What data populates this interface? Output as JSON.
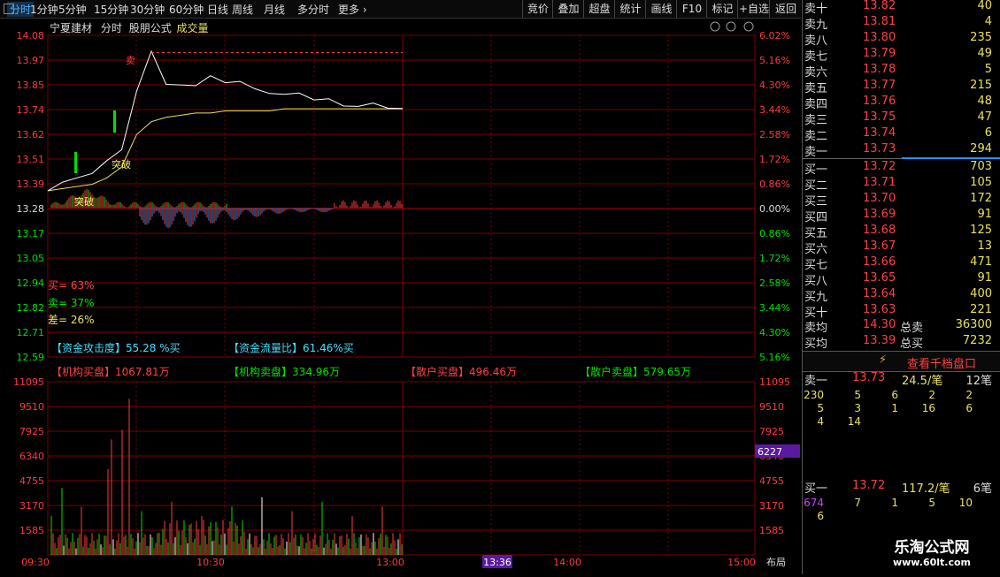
{
  "colors": {
    "up": "#ff3b3b",
    "down": "#00e000",
    "grid": "#7a0000",
    "price_line": "#ffffff",
    "avg_line": "#e8e060",
    "blue": "#1e90ff",
    "cyan": "#44ddff"
  },
  "topbar": {
    "tabs": [
      "分时",
      "1分钟",
      "5分钟",
      "15分钟",
      "30分钟",
      "60分钟",
      "日线",
      "周线",
      "月线",
      "多分时",
      "更多"
    ],
    "active": "分时",
    "right_buttons": [
      "竞价",
      "叠加",
      "超盘",
      "统计",
      "画线",
      "F10",
      "标记",
      "+自选",
      "返回"
    ]
  },
  "chart_header": {
    "stock_name": "宁夏建材",
    "mode": "分时",
    "formula": "股朋公式",
    "vol_label": "成交量"
  },
  "price_axis": {
    "left": [
      "14.08",
      "13.97",
      "13.85",
      "13.74",
      "13.62",
      "13.51",
      "13.39",
      "13.28",
      "13.17",
      "13.05",
      "12.94",
      "12.82",
      "12.71",
      "12.59"
    ],
    "right": [
      "6.02%",
      "5.16%",
      "4.30%",
      "3.44%",
      "2.58%",
      "1.72%",
      "0.86%",
      "0.00%",
      "0.86%",
      "1.72%",
      "2.58%",
      "3.44%",
      "4.30%",
      "5.16%"
    ]
  },
  "volume_axis": {
    "labels": [
      "11095",
      "9510",
      "7925",
      "6340",
      "4755",
      "3170",
      "1585"
    ],
    "marker": "6227"
  },
  "time_axis": {
    "labels": [
      "09:30",
      "10:30",
      "13:00",
      "14:00",
      "15:00"
    ],
    "cursor_time": "13:36",
    "layout_btn": "布局"
  },
  "annotations": {
    "sell_mark": "卖",
    "breakout1": "突破",
    "breakout2": "突破"
  },
  "ratios": {
    "buy": "买= 63%",
    "sell": "卖= 37%",
    "diff": "差= 26%"
  },
  "fund": {
    "attack": "【资金攻击度】55.28 %买",
    "flow": "【资金流量比】61.46%买",
    "inst_buy": "【机构买盘】1067.81万",
    "inst_sell": "【机构卖盘】334.96万",
    "retail_buy": "【散户买盘】496.46万",
    "retail_sell": "【散户卖盘】579.65万"
  },
  "chart_data": {
    "type": "line",
    "title": "宁夏建材 分时",
    "prev_close": 13.28,
    "ylim": [
      12.59,
      14.08
    ],
    "x": [
      "09:30",
      "09:35",
      "09:40",
      "09:45",
      "09:50",
      "09:55",
      "10:00",
      "10:05",
      "10:10",
      "10:15",
      "10:20",
      "10:25",
      "10:30",
      "10:35",
      "10:40",
      "10:45",
      "10:50",
      "10:55",
      "11:00",
      "11:05",
      "11:10",
      "11:15",
      "11:20",
      "11:25",
      "11:30"
    ],
    "series": [
      {
        "name": "price",
        "values": [
          13.36,
          13.4,
          13.42,
          13.44,
          13.5,
          13.55,
          13.82,
          14.0,
          13.86,
          13.85,
          13.84,
          13.9,
          13.86,
          13.86,
          13.84,
          13.81,
          13.8,
          13.82,
          13.78,
          13.78,
          13.76,
          13.75,
          13.76,
          13.75,
          13.74
        ]
      },
      {
        "name": "avg",
        "values": [
          13.36,
          13.37,
          13.38,
          13.39,
          13.42,
          13.47,
          13.62,
          13.68,
          13.7,
          13.71,
          13.72,
          13.72,
          13.73,
          13.73,
          13.73,
          13.73,
          13.74,
          13.74,
          13.74,
          13.74,
          13.74,
          13.74,
          13.74,
          13.74,
          13.74
        ]
      }
    ],
    "volume_ylim": [
      0,
      11095
    ]
  },
  "orderbook": {
    "asks": [
      {
        "label": "卖十",
        "price": "13.82",
        "vol": "40"
      },
      {
        "label": "卖九",
        "price": "13.81",
        "vol": "4"
      },
      {
        "label": "卖八",
        "price": "13.80",
        "vol": "235"
      },
      {
        "label": "卖七",
        "price": "13.79",
        "vol": "49"
      },
      {
        "label": "卖六",
        "price": "13.78",
        "vol": "5"
      },
      {
        "label": "卖五",
        "price": "13.77",
        "vol": "215"
      },
      {
        "label": "卖四",
        "price": "13.76",
        "vol": "48"
      },
      {
        "label": "卖三",
        "price": "13.75",
        "vol": "47"
      },
      {
        "label": "卖二",
        "price": "13.74",
        "vol": "6"
      },
      {
        "label": "卖一",
        "price": "13.73",
        "vol": "294"
      }
    ],
    "bids": [
      {
        "label": "买一",
        "price": "13.72",
        "vol": "703"
      },
      {
        "label": "买二",
        "price": "13.71",
        "vol": "105"
      },
      {
        "label": "买三",
        "price": "13.70",
        "vol": "172"
      },
      {
        "label": "买四",
        "price": "13.69",
        "vol": "91"
      },
      {
        "label": "买五",
        "price": "13.68",
        "vol": "125"
      },
      {
        "label": "买六",
        "price": "13.67",
        "vol": "13"
      },
      {
        "label": "买七",
        "price": "13.66",
        "vol": "471"
      },
      {
        "label": "买八",
        "price": "13.65",
        "vol": "91"
      },
      {
        "label": "买九",
        "price": "13.64",
        "vol": "400"
      },
      {
        "label": "买十",
        "price": "13.63",
        "vol": "221"
      }
    ],
    "ask_avg": {
      "label": "卖均",
      "price": "14.30",
      "tlabel": "总卖",
      "tval": "36300"
    },
    "bid_avg": {
      "label": "买均",
      "price": "13.39",
      "tlabel": "总买",
      "tval": "7232"
    },
    "detail_btn": "查看千档盘口",
    "sell1": {
      "label": "卖一",
      "price": "13.73",
      "per": "24.5/笔",
      "count": "12笔",
      "rows": [
        [
          "230",
          "5",
          "6",
          "2",
          "2"
        ],
        [
          "5",
          "3",
          "1",
          "16",
          "6"
        ],
        [
          "4",
          "14",
          "",
          "",
          ""
        ]
      ]
    },
    "buy1": {
      "label": "买一",
      "price": "13.72",
      "per": "117.2/笔",
      "count": "6笔",
      "rows": [
        [
          "674",
          "7",
          "1",
          "5",
          "10"
        ],
        [
          "6",
          "",
          "",
          "",
          ""
        ]
      ]
    }
  },
  "watermark": {
    "title": "乐淘公式网",
    "url": "www.60lt.com"
  }
}
